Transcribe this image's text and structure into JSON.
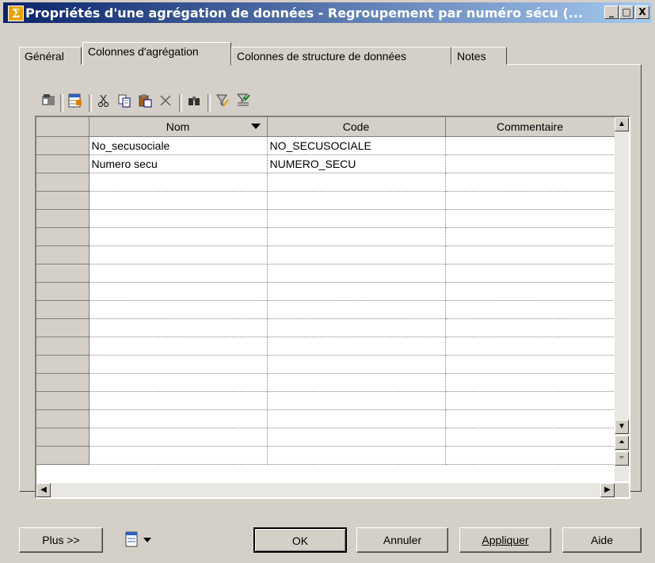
{
  "window": {
    "title": "Propriétés d'une agrégation de données - Regroupement par numéro sécu (...",
    "title_icon": "Σ",
    "caption_buttons": {
      "minimize": "_",
      "maximize": "□",
      "close": "X"
    }
  },
  "tabs": [
    {
      "label": "Général",
      "active": false
    },
    {
      "label": "Colonnes d'agrégation",
      "active": true
    },
    {
      "label": "Colonnes de structure de données",
      "active": false
    },
    {
      "label": "Notes",
      "active": false
    }
  ],
  "toolbar": {
    "icons": [
      "properties-icon",
      "add-columns-icon",
      "cut-icon",
      "copy-icon",
      "paste-icon",
      "delete-icon",
      "find-icon",
      "filter-icon",
      "clear-filter-icon"
    ]
  },
  "grid": {
    "columns": [
      "Nom",
      "Code",
      "Commentaire"
    ],
    "rows": [
      {
        "name": "No_secusociale",
        "code": "NO_SECUSOCIALE",
        "comment": ""
      },
      {
        "name": "Numero secu",
        "code": "NUMERO_SECU",
        "comment": ""
      }
    ],
    "empty_row_count": 16
  },
  "buttons": {
    "plus": "Plus >>",
    "ok": "OK",
    "annuler": "Annuler",
    "appliquer": "Appliquer",
    "aide": "Aide"
  },
  "colors": {
    "titlebar_start": "#0a246a",
    "titlebar_end": "#a6caf0",
    "face": "#d4d0c8"
  }
}
